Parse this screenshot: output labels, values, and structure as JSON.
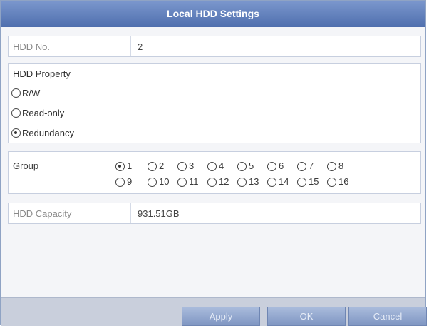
{
  "dialog": {
    "title": "Local HDD Settings"
  },
  "hdd_no": {
    "label": "HDD No.",
    "value": "2"
  },
  "property": {
    "heading": "HDD Property",
    "options": [
      {
        "label": "R/W",
        "selected": false
      },
      {
        "label": "Read-only",
        "selected": false
      },
      {
        "label": "Redundancy",
        "selected": true
      }
    ]
  },
  "group": {
    "label": "Group",
    "options": [
      {
        "label": "1",
        "selected": true
      },
      {
        "label": "2",
        "selected": false
      },
      {
        "label": "3",
        "selected": false
      },
      {
        "label": "4",
        "selected": false
      },
      {
        "label": "5",
        "selected": false
      },
      {
        "label": "6",
        "selected": false
      },
      {
        "label": "7",
        "selected": false
      },
      {
        "label": "8",
        "selected": false
      },
      {
        "label": "9",
        "selected": false
      },
      {
        "label": "10",
        "selected": false
      },
      {
        "label": "11",
        "selected": false
      },
      {
        "label": "12",
        "selected": false
      },
      {
        "label": "13",
        "selected": false
      },
      {
        "label": "14",
        "selected": false
      },
      {
        "label": "15",
        "selected": false
      },
      {
        "label": "16",
        "selected": false
      }
    ]
  },
  "capacity": {
    "label": "HDD Capacity",
    "value": "931.51GB"
  },
  "buttons": {
    "apply": "Apply",
    "ok": "OK",
    "cancel": "Cancel"
  },
  "colors": {
    "title_bar": "#5f7dbb",
    "button": "#8fa4cc",
    "footer": "#c9cfdc"
  }
}
